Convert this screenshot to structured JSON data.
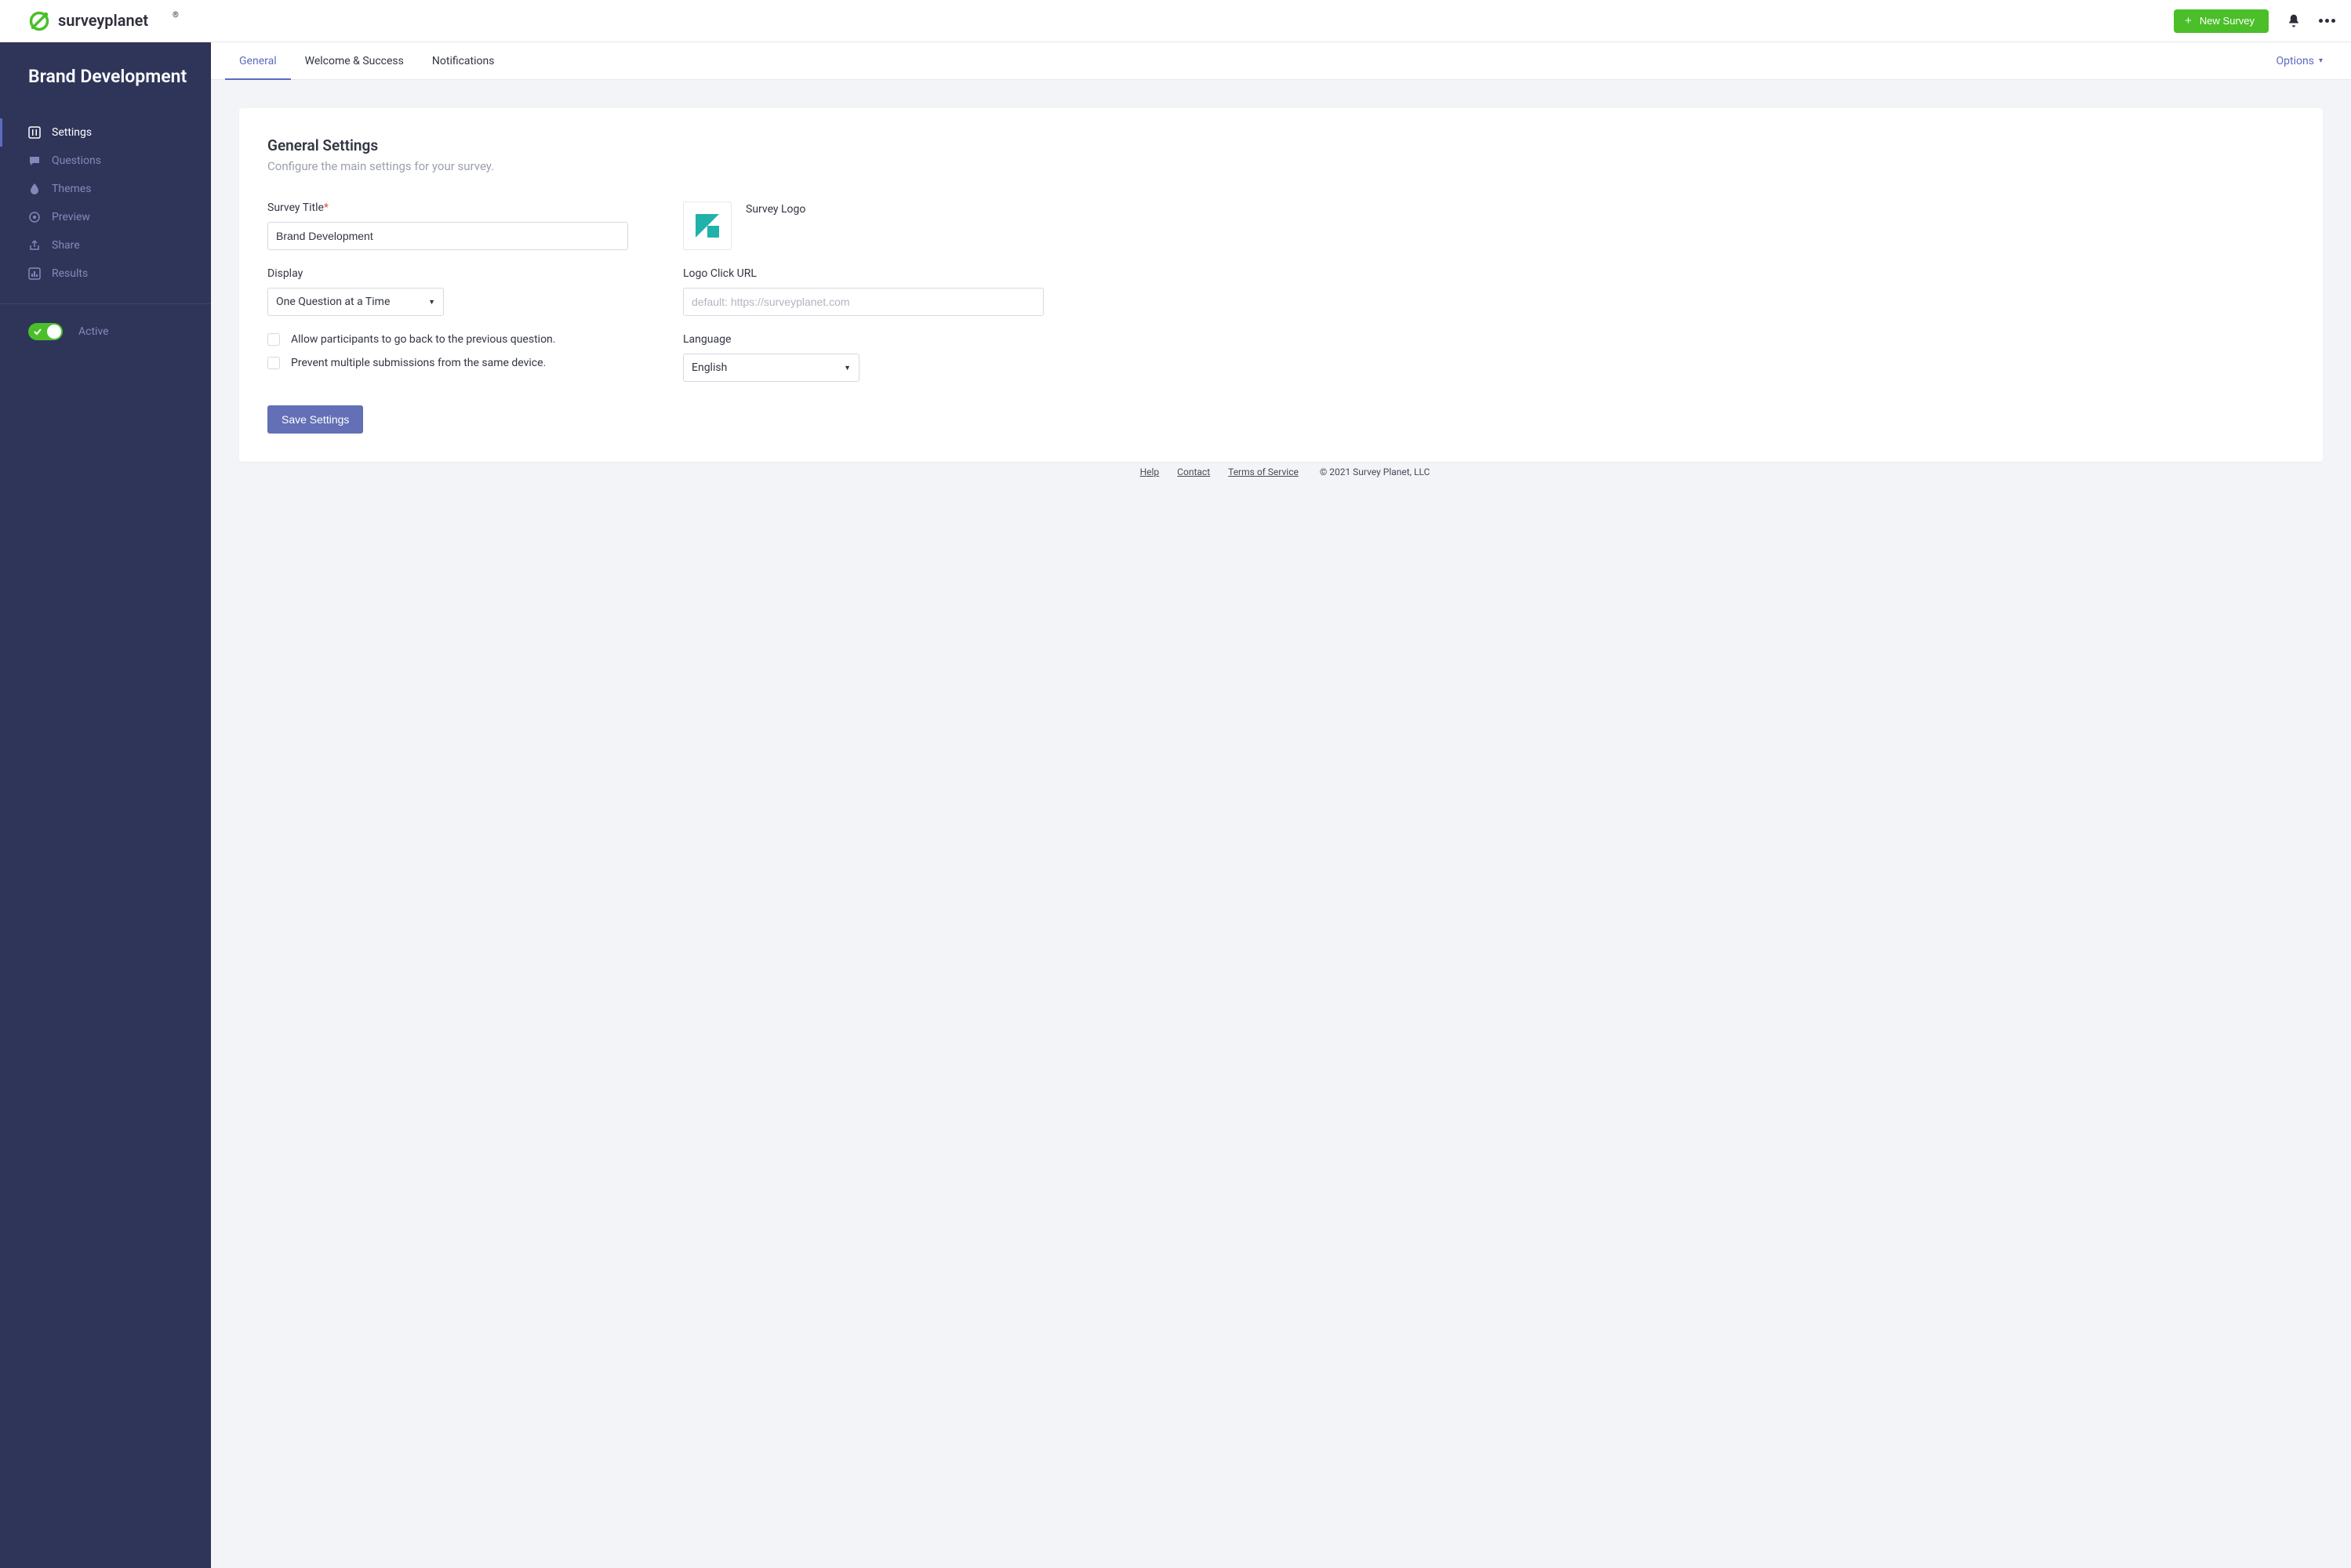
{
  "brand": {
    "name": "surveyplanet"
  },
  "header": {
    "new_survey_label": "New Survey"
  },
  "sidebar": {
    "survey_title": "Brand Development",
    "items": [
      {
        "label": "Settings"
      },
      {
        "label": "Questions"
      },
      {
        "label": "Themes"
      },
      {
        "label": "Preview"
      },
      {
        "label": "Share"
      },
      {
        "label": "Results"
      }
    ],
    "active_label": "Active"
  },
  "tabs": {
    "items": [
      {
        "label": "General"
      },
      {
        "label": "Welcome & Success"
      },
      {
        "label": "Notifications"
      }
    ],
    "options_label": "Options"
  },
  "panel": {
    "title": "General Settings",
    "subtitle": "Configure the main settings for your survey.",
    "survey_title_label": "Survey Title",
    "survey_title_value": "Brand Development",
    "display_label": "Display",
    "display_value": "One Question at a Time",
    "allow_back_label": "Allow participants to go back to the previous question.",
    "prevent_multi_label": "Prevent multiple submissions from the same device.",
    "survey_logo_label": "Survey Logo",
    "logo_url_label": "Logo Click URL",
    "logo_url_placeholder": "default: https://surveyplanet.com",
    "language_label": "Language",
    "language_value": "English",
    "save_label": "Save Settings"
  },
  "footer": {
    "help": "Help",
    "contact": "Contact",
    "tos": "Terms of Service",
    "copyright": "© 2021 Survey Planet, LLC"
  }
}
